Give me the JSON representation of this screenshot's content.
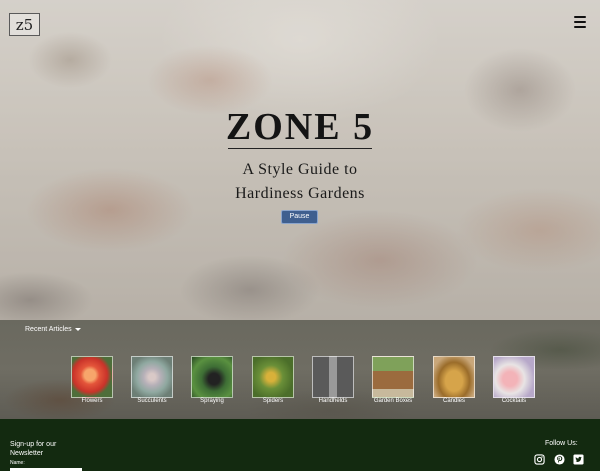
{
  "header": {
    "logo_text": "z5",
    "menu_icon": "hamburger-icon"
  },
  "hero": {
    "title": "ZONE 5",
    "subtitle_line1": "A Style Guide to",
    "subtitle_line2": "Hardiness Gardens",
    "pause_label": "Pause"
  },
  "articles": {
    "heading": "Recent Articles",
    "items": [
      {
        "label": "Flowers"
      },
      {
        "label": "Succulents"
      },
      {
        "label": "Spraying"
      },
      {
        "label": "Spiders"
      },
      {
        "label": "Handhelds"
      },
      {
        "label": "Garden Boxes"
      },
      {
        "label": "Candles"
      },
      {
        "label": "Cocktails"
      }
    ]
  },
  "footer": {
    "signup_line1": "Sign-up for our",
    "signup_line2": "Newsletter",
    "name_label": "Name:",
    "name_value": "",
    "follow_label": "Follow Us:",
    "social_icons": [
      "instagram-icon",
      "pinterest-icon",
      "twitter-icon"
    ]
  },
  "colors": {
    "footer_bg": "#132a10",
    "pause_button": "#3f5f8f"
  }
}
